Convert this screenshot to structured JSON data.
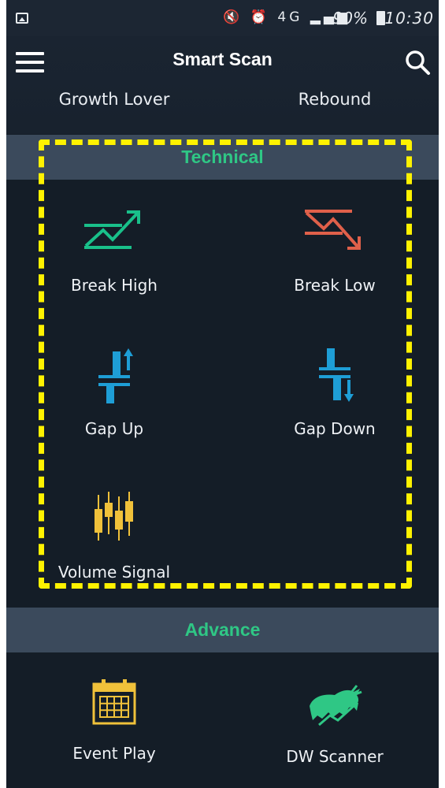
{
  "status_bar": {
    "icons": "🔇 ⏰ 4G ▂▄▆",
    "battery": "90%",
    "time": "10:30"
  },
  "header": {
    "title": "Smart Scan",
    "sub_items": [
      "Growth Lover",
      "Rebound"
    ]
  },
  "sections": {
    "technical": {
      "title": "Technical",
      "items": [
        {
          "label": "Break High",
          "icon": "break-high-icon",
          "color": "#19c08a"
        },
        {
          "label": "Break Low",
          "icon": "break-low-icon",
          "color": "#e0604a"
        },
        {
          "label": "Gap Up",
          "icon": "gap-up-icon",
          "color": "#1e9ed6"
        },
        {
          "label": "Gap Down",
          "icon": "gap-down-icon",
          "color": "#1e9ed6"
        },
        {
          "label": "Volume Signal",
          "icon": "volume-signal-icon",
          "color": "#f0c13a"
        }
      ]
    },
    "advance": {
      "title": "Advance",
      "items": [
        {
          "label": "Event Play",
          "icon": "calendar-icon",
          "color": "#f0c13a"
        },
        {
          "label": "DW Scanner",
          "icon": "bull-icon",
          "color": "#2fc785"
        }
      ]
    }
  },
  "colors": {
    "accent_green": "#2fc785",
    "highlight_yellow": "#fff200",
    "background": "#141d27",
    "section_bg": "#3b4a5c"
  }
}
